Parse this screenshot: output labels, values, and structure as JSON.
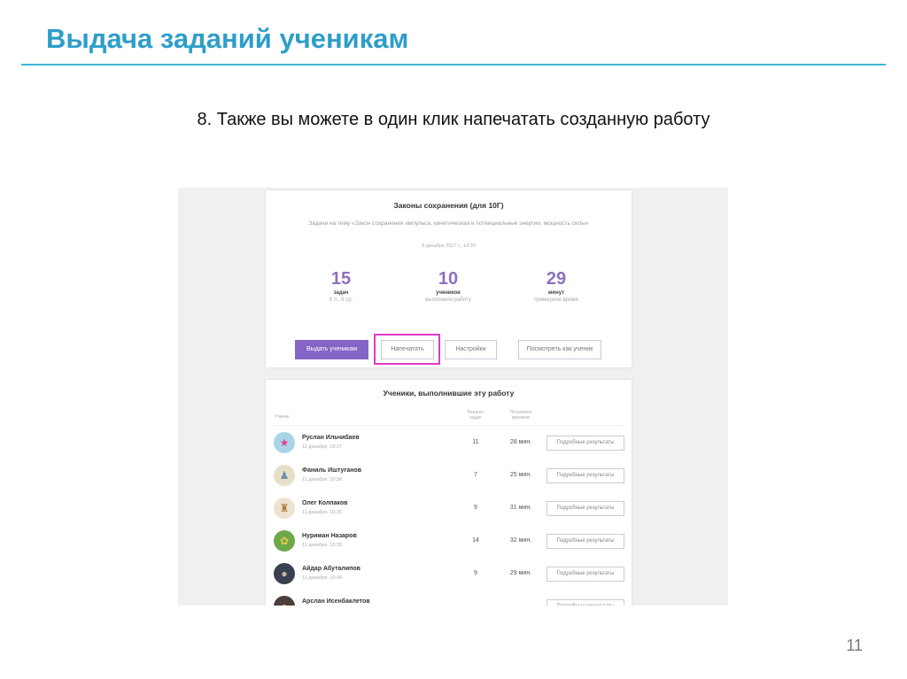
{
  "slide": {
    "title": "Выдача заданий ученикам",
    "subtitle": "8. Также вы можете в один клик напечатать созданную работу",
    "page_number": "11",
    "accent_color": "#2e9ec9"
  },
  "work": {
    "title": "Законы сохранения (для 10Г)",
    "description": "Задачи на тему «Закон сохранения импульса, кинетическая и потенциальные энергии, мощность силы»",
    "date": "9 декабря 2017 г., 14:30",
    "stats": [
      {
        "value": "15",
        "label": "задач",
        "sub": "9 л., 6 ср."
      },
      {
        "value": "10",
        "label": "учеников",
        "sub": "выполнили работу"
      },
      {
        "value": "29",
        "label": "минут",
        "sub": "примерное время"
      }
    ],
    "buttons": {
      "issue": "Выдать ученикам",
      "print": "Напечатать",
      "settings": "Настройки",
      "view_as_student": "Посмотреть как ученик"
    },
    "highlight_color": "#df39c7",
    "button_color": "#8464c4"
  },
  "students": {
    "title": "Ученики, выполнившие эту работу",
    "headers": {
      "student": "Ученик",
      "solved": "Решено задач",
      "time": "Потрачено времени"
    },
    "details_label": "Подробные результаты",
    "rows": [
      {
        "name": "Руслан Ильчибаев",
        "date": "11 декабря, 10:37",
        "solved": "11",
        "time": "28 мин.",
        "avatar": "star-icon"
      },
      {
        "name": "Фаниль Иштуганов",
        "date": "11 декабря, 10:36",
        "solved": "7",
        "time": "25 мин.",
        "avatar": "figure-icon"
      },
      {
        "name": "Олег Колпаков",
        "date": "11 декабря, 10:35",
        "solved": "9",
        "time": "31 мин.",
        "avatar": "figure-icon"
      },
      {
        "name": "Нуриман Назаров",
        "date": "11 декабря, 10:35",
        "solved": "14",
        "time": "32 мин.",
        "avatar": "plant-icon"
      },
      {
        "name": "Айдар Абуталипов",
        "date": "11 декабря, 10:34",
        "solved": "9",
        "time": "29 мин.",
        "avatar": "photo-icon"
      },
      {
        "name": "Арслан Исенбаклетов",
        "date": "",
        "solved": "",
        "time": "",
        "avatar": "photo-icon"
      }
    ]
  }
}
